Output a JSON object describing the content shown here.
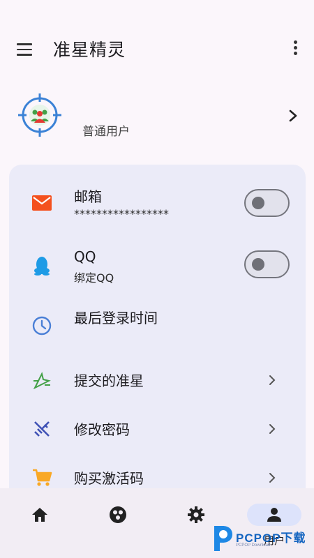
{
  "app_bar": {
    "title": "准星精灵",
    "menu_icon": "hamburger-menu-icon",
    "more_icon": "more-vertical-icon"
  },
  "profile": {
    "avatar_icon": "crosshair-group-icon",
    "role": "普通用户",
    "chevron_icon": "chevron-right-icon"
  },
  "settings": {
    "email": {
      "icon": "mail-icon",
      "title": "邮箱",
      "value": "*****************",
      "toggle_on": false
    },
    "qq": {
      "icon": "qq-penguin-icon",
      "title": "QQ",
      "value": "绑定QQ",
      "toggle_on": false
    },
    "last_login": {
      "icon": "clock-icon",
      "title": "最后登录时间"
    },
    "submitted": {
      "icon": "submit-crosshair-icon",
      "title": "提交的准星"
    },
    "password": {
      "icon": "password-icon",
      "title": "修改密码"
    },
    "activation": {
      "icon": "shopping-cart-icon",
      "title": "购买激活码"
    }
  },
  "bottom_nav": {
    "items": [
      {
        "icon": "home-icon",
        "label": ""
      },
      {
        "icon": "crosshair-library-icon",
        "label": ""
      },
      {
        "icon": "gear-icon",
        "label": ""
      },
      {
        "icon": "user-icon",
        "label": "用户",
        "active": true
      }
    ]
  },
  "watermark": {
    "text": "PCPOP下载",
    "small": "PCPOP Download"
  },
  "colors": {
    "background": "#fbf6fb",
    "card": "#ebebf8",
    "mail": "#f4511e",
    "qq": "#1e9be6",
    "clock": "#4a7fd6",
    "submit": "#43a047",
    "password": "#3f51b5",
    "cart": "#f9a825",
    "nav_active": "#dde3fb"
  }
}
